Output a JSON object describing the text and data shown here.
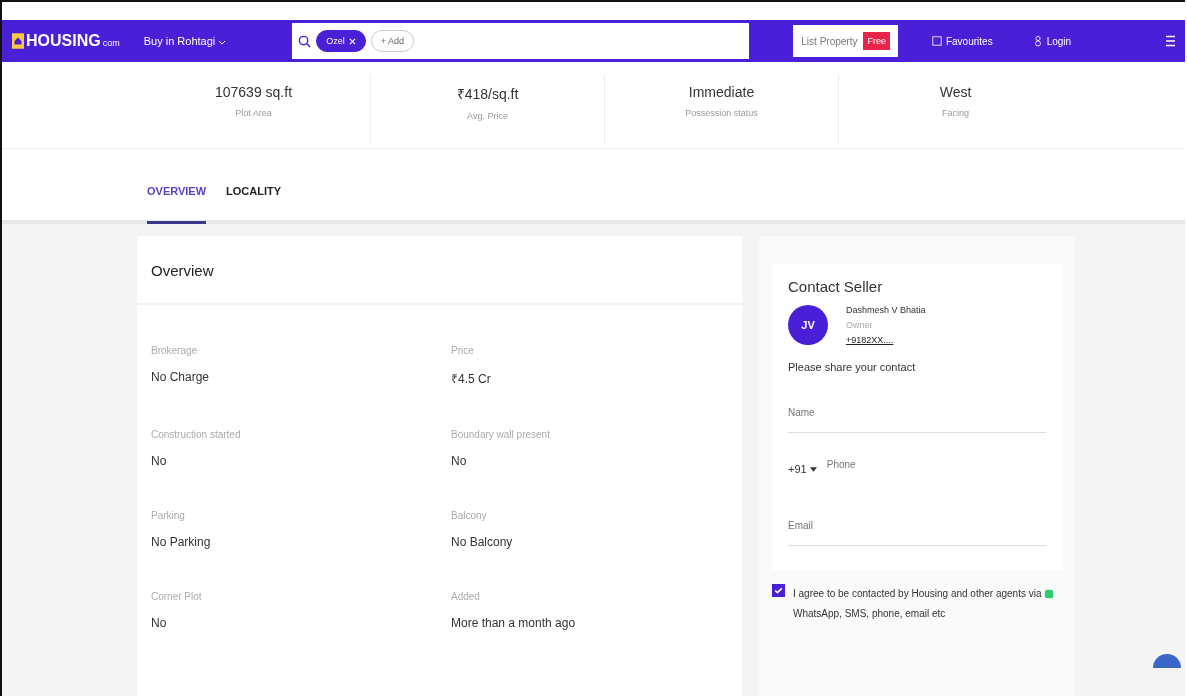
{
  "header": {
    "logo": "HOUSING",
    "logo_suffix": "com",
    "city_menu": "Buy in Rohtagi",
    "search_chips": [
      {
        "label": "Ozel",
        "removable": true
      },
      {
        "label": "+ Add",
        "removable": false
      }
    ],
    "list_property": "List Property",
    "free_badge": "Free",
    "favourites": "Favourites",
    "login": "Login"
  },
  "stats": [
    {
      "value": "107639 sq.ft",
      "label": "Plot Area"
    },
    {
      "value": "₹418/sq.ft",
      "label": "Avg. Price"
    },
    {
      "value": "Immediate",
      "label": "Possession status"
    },
    {
      "value": "West",
      "label": "Facing"
    }
  ],
  "tabs": [
    {
      "label": "OVERVIEW",
      "selected": true
    },
    {
      "label": "LOCALITY",
      "selected": false
    }
  ],
  "overview": {
    "title": "Overview",
    "items": [
      {
        "label": "Brokerage",
        "value": "No Charge"
      },
      {
        "label": "Price",
        "value": "₹4.5 Cr"
      },
      {
        "label": "Construction started",
        "value": "No"
      },
      {
        "label": "Boundary wall present",
        "value": "No"
      },
      {
        "label": "Parking",
        "value": "No Parking"
      },
      {
        "label": "Balcony",
        "value": "No Balcony"
      },
      {
        "label": "Corner Plot",
        "value": "No"
      },
      {
        "label": "Added",
        "value": "More than a month ago"
      }
    ]
  },
  "contact": {
    "title": "Contact Seller",
    "avatar": "JV",
    "seller_name": "Dashmesh V Bhatia",
    "seller_role": "Owner",
    "seller_phone": "+9182XX....",
    "prompt": "Please share your contact",
    "name_placeholder": "Name",
    "country_code": "+91",
    "phone_placeholder": "Phone",
    "email_placeholder": "Email",
    "consent_checked": true,
    "consent_text": "I agree to be contacted by Housing and other agents via",
    "consent_channels": "WhatsApp, SMS, phone, email etc"
  }
}
